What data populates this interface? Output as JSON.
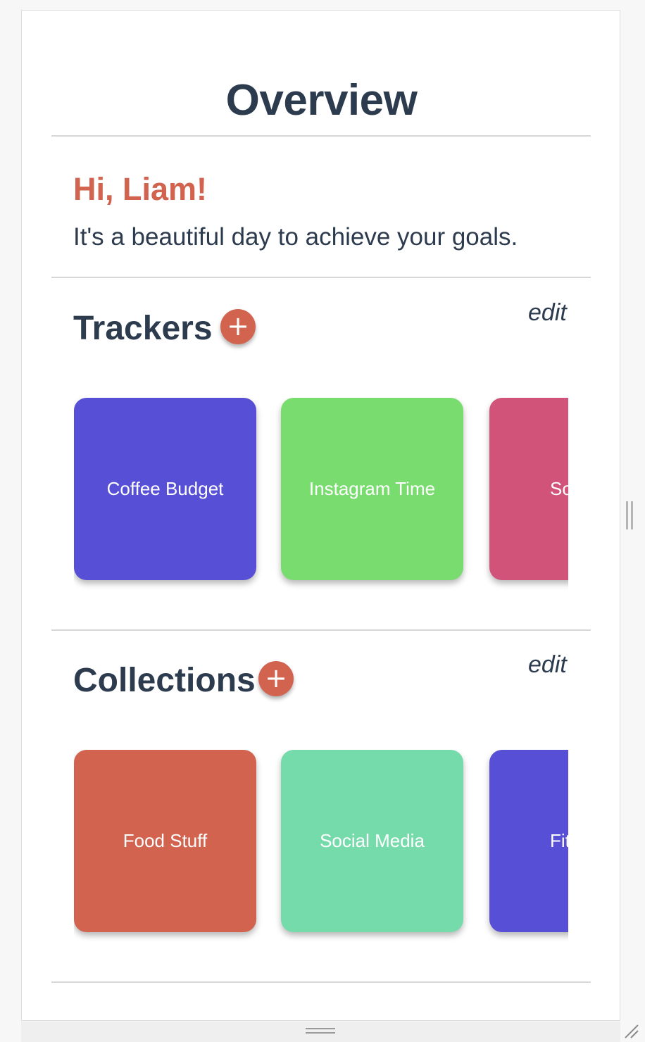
{
  "header": {
    "title": "Overview"
  },
  "greeting": {
    "title": "Hi, Liam!",
    "subtitle": "It's a beautiful day to achieve your goals."
  },
  "trackers": {
    "title": "Trackers",
    "add_label": "+",
    "edit_label": "edit",
    "items": [
      {
        "label": "Coffee Budget",
        "color": "#574fd6"
      },
      {
        "label": "Instagram Time",
        "color": "#78dc6e"
      },
      {
        "label": "So",
        "color": "#d1537a"
      }
    ]
  },
  "collections": {
    "title": "Collections",
    "add_label": "+",
    "edit_label": "edit",
    "items": [
      {
        "label": "Food Stuff",
        "color": "#d1634f"
      },
      {
        "label": "Social Media",
        "color": "#75dbab"
      },
      {
        "label": "Fit",
        "color": "#574fd6"
      }
    ]
  },
  "colors": {
    "accent": "#d1634f",
    "text_dark": "#2d3b4e",
    "divider": "#d7d7d7"
  }
}
